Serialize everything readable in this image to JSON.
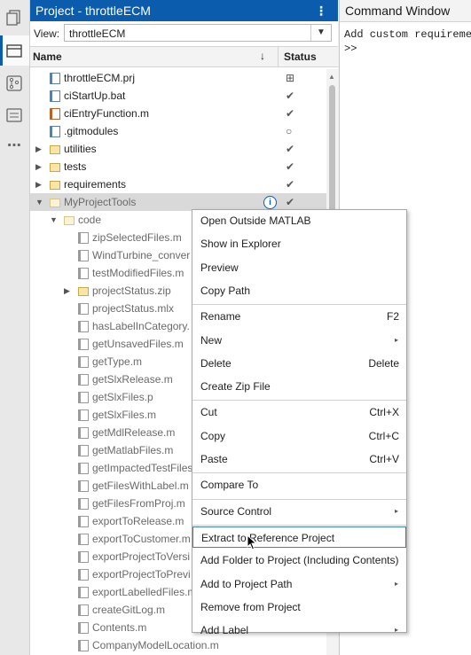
{
  "project_panel": {
    "title": "Project - throttleECM",
    "menu_glyph": "⋮",
    "view_label": "View:",
    "view_value": "throttleECM",
    "col_name": "Name",
    "col_status": "Status",
    "sort_glyph": "↓"
  },
  "files": [
    {
      "name": "throttleECM.prj",
      "indent": 0,
      "twisty": "",
      "icon": "project-file-icon",
      "status": "⊞",
      "status_icon": "project-status-icon"
    },
    {
      "name": "ciStartUp.bat",
      "indent": 0,
      "twisty": "",
      "icon": "text-file-icon",
      "status": "✔",
      "status_icon": "check-icon"
    },
    {
      "name": "ciEntryFunction.m",
      "indent": 0,
      "twisty": "",
      "icon": "function-file-icon",
      "status": "✔",
      "status_icon": "check-icon"
    },
    {
      "name": ".gitmodules",
      "indent": 0,
      "twisty": "",
      "icon": "text-file-icon",
      "status": "○",
      "status_icon": "circle-icon"
    },
    {
      "name": "utilities",
      "indent": 0,
      "twisty": "▶",
      "icon": "folder-icon",
      "status": "✔",
      "status_icon": "check-icon"
    },
    {
      "name": "tests",
      "indent": 0,
      "twisty": "▶",
      "icon": "folder-icon",
      "status": "✔",
      "status_icon": "check-icon"
    },
    {
      "name": "requirements",
      "indent": 0,
      "twisty": "▶",
      "icon": "folder-icon",
      "status": "✔",
      "status_icon": "check-icon"
    },
    {
      "name": "MyProjectTools",
      "indent": 0,
      "twisty": "▼",
      "icon": "folder-icon",
      "status": "✔",
      "status_icon": "check-icon",
      "grey": true,
      "highlight": true,
      "info": "i"
    },
    {
      "name": "code",
      "indent": 1,
      "twisty": "▼",
      "icon": "folder-icon",
      "status": "",
      "grey": true
    },
    {
      "name": "zipSelectedFiles.m",
      "indent": 2,
      "twisty": "",
      "icon": "m-file-icon",
      "status": "",
      "grey": true
    },
    {
      "name": "WindTurbine_conver",
      "indent": 2,
      "twisty": "",
      "icon": "data-file-icon",
      "status": "",
      "grey": true
    },
    {
      "name": "testModifiedFiles.m",
      "indent": 2,
      "twisty": "",
      "icon": "m-file-icon",
      "status": "",
      "grey": true
    },
    {
      "name": "projectStatus.zip",
      "indent": 2,
      "twisty": "▶",
      "icon": "zip-folder-icon",
      "status": "",
      "grey": true
    },
    {
      "name": "projectStatus.mlx",
      "indent": 2,
      "twisty": "",
      "icon": "live-script-icon",
      "status": "",
      "grey": true
    },
    {
      "name": "hasLabelInCategory.",
      "indent": 2,
      "twisty": "",
      "icon": "m-file-icon",
      "status": "",
      "grey": true
    },
    {
      "name": "getUnsavedFiles.m",
      "indent": 2,
      "twisty": "",
      "icon": "m-file-icon",
      "status": "",
      "grey": true
    },
    {
      "name": "getType.m",
      "indent": 2,
      "twisty": "",
      "icon": "m-file-icon",
      "status": "",
      "grey": true
    },
    {
      "name": "getSlxRelease.m",
      "indent": 2,
      "twisty": "",
      "icon": "m-file-icon",
      "status": "",
      "grey": true
    },
    {
      "name": "getSlxFiles.p",
      "indent": 2,
      "twisty": "",
      "icon": "p-file-icon",
      "status": "",
      "grey": true
    },
    {
      "name": "getSlxFiles.m",
      "indent": 2,
      "twisty": "",
      "icon": "m-file-icon",
      "status": "",
      "grey": true
    },
    {
      "name": "getMdlRelease.m",
      "indent": 2,
      "twisty": "",
      "icon": "m-file-icon",
      "status": "",
      "grey": true
    },
    {
      "name": "getMatlabFiles.m",
      "indent": 2,
      "twisty": "",
      "icon": "m-file-icon",
      "status": "",
      "grey": true
    },
    {
      "name": "getImpactedTestFiles",
      "indent": 2,
      "twisty": "",
      "icon": "m-file-icon",
      "status": "",
      "grey": true
    },
    {
      "name": "getFilesWithLabel.m",
      "indent": 2,
      "twisty": "",
      "icon": "m-file-icon",
      "status": "",
      "grey": true
    },
    {
      "name": "getFilesFromProj.m",
      "indent": 2,
      "twisty": "",
      "icon": "m-file-icon",
      "status": "",
      "grey": true
    },
    {
      "name": "exportToRelease.m",
      "indent": 2,
      "twisty": "",
      "icon": "m-file-icon",
      "status": "",
      "grey": true
    },
    {
      "name": "exportToCustomer.m",
      "indent": 2,
      "twisty": "",
      "icon": "m-file-icon",
      "status": "",
      "grey": true
    },
    {
      "name": "exportProjectToVersi",
      "indent": 2,
      "twisty": "",
      "icon": "m-file-icon",
      "status": "",
      "grey": true
    },
    {
      "name": "exportProjectToPrevi",
      "indent": 2,
      "twisty": "",
      "icon": "m-file-icon",
      "status": "",
      "grey": true
    },
    {
      "name": "exportLabelledFiles.m",
      "indent": 2,
      "twisty": "",
      "icon": "m-file-icon",
      "status": "",
      "grey": true
    },
    {
      "name": "createGitLog.m",
      "indent": 2,
      "twisty": "",
      "icon": "m-file-icon",
      "status": "",
      "grey": true
    },
    {
      "name": "Contents.m",
      "indent": 2,
      "twisty": "",
      "icon": "m-file-icon",
      "status": "",
      "grey": true
    },
    {
      "name": "CompanyModelLocation.m",
      "indent": 2,
      "twisty": "",
      "icon": "m-file-icon",
      "status": "",
      "grey": true
    }
  ],
  "command_window": {
    "title": "Command Window",
    "lines": [
      "Add custom requireme",
      ">>"
    ]
  },
  "context_menu": [
    {
      "label": "Open Outside MATLAB",
      "shortcut": ""
    },
    {
      "label": "Show in Explorer",
      "shortcut": ""
    },
    {
      "label": "Preview",
      "shortcut": ""
    },
    {
      "label": "Copy Path",
      "shortcut": ""
    },
    {
      "sep": true
    },
    {
      "label": "Rename",
      "shortcut": "F2"
    },
    {
      "label": "New",
      "shortcut": "",
      "submenu": true
    },
    {
      "label": "Delete",
      "shortcut": "Delete"
    },
    {
      "label": "Create Zip File",
      "shortcut": ""
    },
    {
      "sep": true
    },
    {
      "label": "Cut",
      "shortcut": "Ctrl+X"
    },
    {
      "label": "Copy",
      "shortcut": "Ctrl+C"
    },
    {
      "label": "Paste",
      "shortcut": "Ctrl+V"
    },
    {
      "sep": true
    },
    {
      "label": "Compare To",
      "shortcut": ""
    },
    {
      "sep": true
    },
    {
      "label": "Source Control",
      "shortcut": "",
      "submenu": true
    },
    {
      "sep": true
    },
    {
      "label": "Extract to Reference Project",
      "shortcut": "",
      "active": true
    },
    {
      "label": "Add Folder to Project (Including Contents)",
      "shortcut": ""
    },
    {
      "label": "Add to Project Path",
      "shortcut": "",
      "submenu": true
    },
    {
      "label": "Remove from Project",
      "shortcut": ""
    },
    {
      "label": "Add Label",
      "shortcut": "",
      "submenu": true
    }
  ],
  "submenu_glyph": "▸",
  "left_strip": [
    "files-icon",
    "project-icon",
    "source-control-icon",
    "changes-icon",
    "more-icon"
  ],
  "more_glyph": "⋯",
  "colors": {
    "accent": "#0b5cad",
    "highlight_row": "#d9d9d9",
    "active_item_border": "#3c7fc1"
  }
}
